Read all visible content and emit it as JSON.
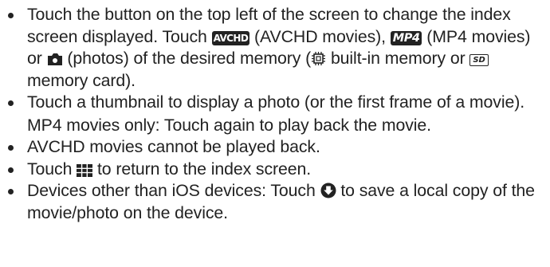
{
  "bullets": [
    {
      "a": "Touch the button on the top left of the screen to change the index screen displayed. Touch ",
      "avchd_label": "AVCHD",
      "b": " (AVCHD movies), ",
      "mp4_label": "MP4",
      "c": " (MP4 movies) or ",
      "d": " (photos) of the desired memory (",
      "e": " built-in mem­ory or ",
      "sd_label": "SD",
      "f": " memory card)."
    },
    {
      "a": "Touch a thumbnail to display a photo (or the first frame of a movie).",
      "note": "MP4 movies only: Touch again to play back the movie."
    },
    {
      "a": "AVCHD movies cannot be played back."
    },
    {
      "a": "Touch ",
      "b": " to return to the index screen."
    },
    {
      "a": "Devices other than iOS devices: Touch ",
      "b": " to save a local copy of the movie/photo on the device."
    }
  ],
  "icons": {
    "avchd": "avchd-badge-icon",
    "mp4": "mp4-badge-icon",
    "photo": "camera-icon",
    "builtin_memory": "built-in-memory-icon",
    "sd": "sd-card-icon",
    "index": "index-grid-icon",
    "save": "download-circle-icon"
  }
}
